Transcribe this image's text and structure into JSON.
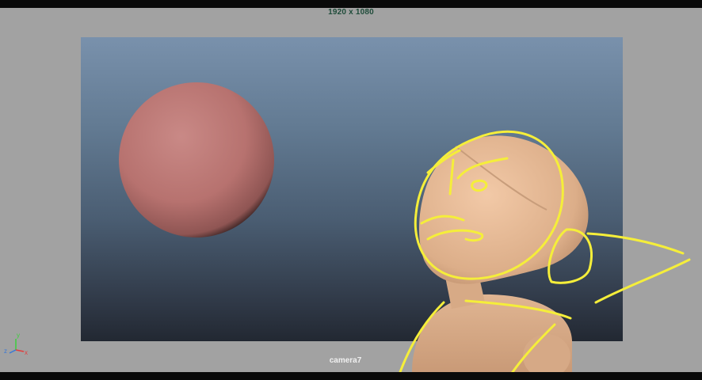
{
  "viewport": {
    "resolution": "1920 x 1080",
    "camera": "camera7"
  },
  "axis_gizmo": {
    "x_label": "x",
    "y_label": "y",
    "z_label": "z"
  },
  "colors": {
    "background": "#a2a2a2",
    "gate_top": "#7991ac",
    "gate_bottom": "#222832",
    "sphere": "#c07f7d",
    "character_skin": "#e2b592",
    "annotation": "#f5ee3a"
  }
}
